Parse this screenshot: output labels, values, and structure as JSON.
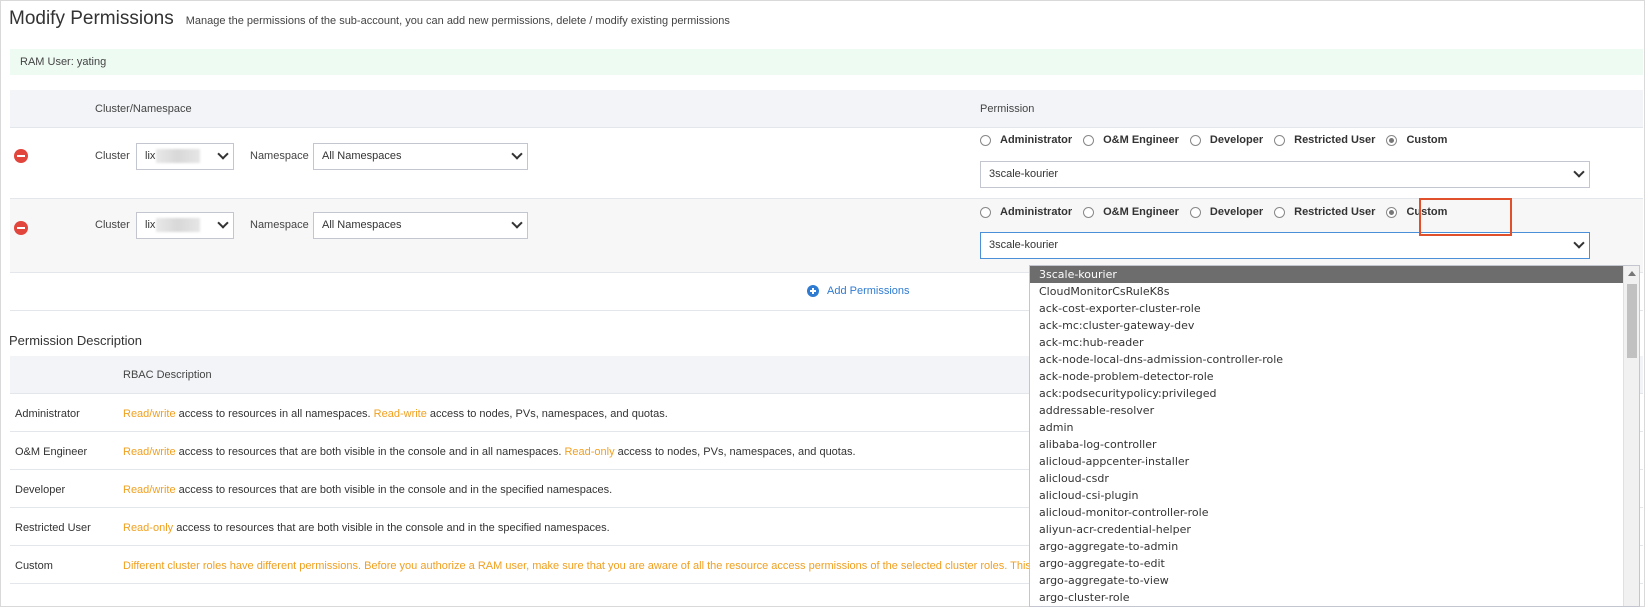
{
  "header": {
    "title": "Modify Permissions",
    "subtitle": "Manage the permissions of the sub-account, you can add new permissions, delete / modify existing permissions"
  },
  "ram_user": "RAM User: yating",
  "table": {
    "col_cluster": "Cluster/Namespace",
    "col_permission": "Permission"
  },
  "rows": [
    {
      "cluster_label": "Cluster",
      "cluster_value": "lix",
      "namespace_label": "Namespace",
      "namespace_value": "All Namespaces",
      "roles": [
        "Administrator",
        "O&M Engineer",
        "Developer",
        "Restricted User",
        "Custom"
      ],
      "selected_role": "Custom",
      "custom_value": "3scale-kourier"
    },
    {
      "cluster_label": "Cluster",
      "cluster_value": "lix",
      "namespace_label": "Namespace",
      "namespace_value": "All Namespaces",
      "roles": [
        "Administrator",
        "O&M Engineer",
        "Developer",
        "Restricted User",
        "Custom"
      ],
      "selected_role": "Custom",
      "custom_value": "3scale-kourier"
    }
  ],
  "add_permissions": "Add Permissions",
  "description": {
    "section_title": "Permission Description",
    "col_rbac": "RBAC Description",
    "rows": [
      {
        "role": "Administrator",
        "h1": "Read/write",
        "t1": " access to resources in all namespaces. ",
        "h2": "Read-write",
        "t2": " access to nodes, PVs, namespaces, and quotas."
      },
      {
        "role": "O&M Engineer",
        "h1": "Read/write",
        "t1": " access to resources that are both visible in the console and in all namespaces. ",
        "h2": "Read-only",
        "t2": " access to nodes, PVs, namespaces, and quotas."
      },
      {
        "role": "Developer",
        "h1": "Read/write",
        "t1": " access to resources that are both visible in the console and in the specified namespaces.",
        "h2": "",
        "t2": ""
      },
      {
        "role": "Restricted User",
        "h1": "Read-only",
        "t1": " access to resources that are both visible in the console and in the specified namespaces.",
        "h2": "",
        "t2": ""
      },
      {
        "role": "Custom",
        "h1": "Different cluster roles have different permissions. Before you authorize a RAM user, make sure that you are aware of all the resource access permissions of the selected cluster roles. This preve",
        "t1": "",
        "h2": "",
        "t2": ""
      }
    ]
  },
  "dropdown_options": [
    "3scale-kourier",
    "CloudMonitorCsRuleK8s",
    "ack-cost-exporter-cluster-role",
    "ack-mc:cluster-gateway-dev",
    "ack-mc:hub-reader",
    "ack-node-local-dns-admission-controller-role",
    "ack-node-problem-detector-role",
    "ack:podsecuritypolicy:privileged",
    "addressable-resolver",
    "admin",
    "alibaba-log-controller",
    "alicloud-appcenter-installer",
    "alicloud-csdr",
    "alicloud-csi-plugin",
    "alicloud-monitor-controller-role",
    "aliyun-acr-credential-helper",
    "argo-aggregate-to-admin",
    "argo-aggregate-to-edit",
    "argo-aggregate-to-view",
    "argo-cluster-role"
  ],
  "colors": {
    "highlight": "#f0a020",
    "link": "#2f7bd1",
    "remove": "#e2453c",
    "annotation_box": "#e0512b"
  }
}
